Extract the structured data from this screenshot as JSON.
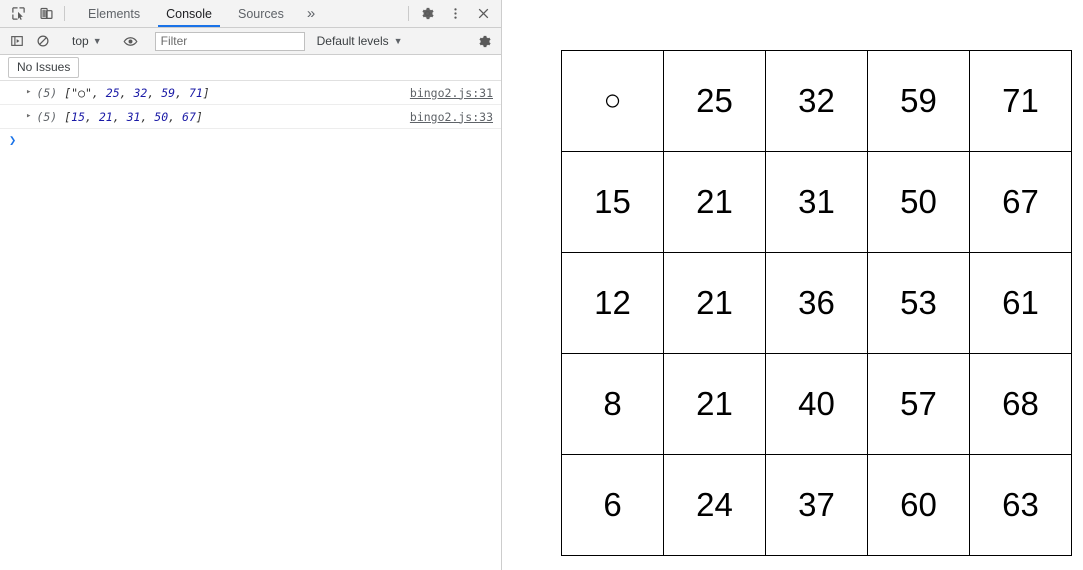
{
  "devtools": {
    "tabbar": {
      "inspect_icon": "inspect-cursor-icon",
      "device_icon": "device-toolbar-icon",
      "tabs": [
        {
          "label": "Elements",
          "active": false
        },
        {
          "label": "Console",
          "active": true
        },
        {
          "label": "Sources",
          "active": false
        }
      ],
      "more_tabs_label": "»",
      "settings_icon": "gear-icon",
      "menu_icon": "kebab-menu-icon",
      "close_icon": "close-icon"
    },
    "toolbar": {
      "sidebar_icon": "console-sidebar-icon",
      "clear_icon": "clear-console-icon",
      "context_label": "top",
      "context_caret": "▼",
      "eye_icon": "live-expression-eye-icon",
      "filter_placeholder": "Filter",
      "filter_value": "",
      "levels_label": "Default levels",
      "levels_caret": "▼",
      "settings_icon": "console-settings-gear-icon"
    },
    "issues": {
      "label": "No Issues"
    },
    "logs": [
      {
        "triangle": "▸",
        "count": "(5)",
        "parts": [
          {
            "t": "[\"",
            "k": "punc"
          },
          {
            "t": "○",
            "k": "str"
          },
          {
            "t": "\", ",
            "k": "punc"
          },
          {
            "t": "25",
            "k": "num"
          },
          {
            "t": ", ",
            "k": "punc"
          },
          {
            "t": "32",
            "k": "num"
          },
          {
            "t": ", ",
            "k": "punc"
          },
          {
            "t": "59",
            "k": "num"
          },
          {
            "t": ", ",
            "k": "punc"
          },
          {
            "t": "71",
            "k": "num"
          },
          {
            "t": "]",
            "k": "punc"
          }
        ],
        "text": "[\"○\", 25, 32, 59, 71]",
        "source": "bingo2.js:31"
      },
      {
        "triangle": "▸",
        "count": "(5)",
        "parts": [
          {
            "t": "[",
            "k": "punc"
          },
          {
            "t": "15",
            "k": "num"
          },
          {
            "t": ", ",
            "k": "punc"
          },
          {
            "t": "21",
            "k": "num"
          },
          {
            "t": ", ",
            "k": "punc"
          },
          {
            "t": "31",
            "k": "num"
          },
          {
            "t": ", ",
            "k": "punc"
          },
          {
            "t": "50",
            "k": "num"
          },
          {
            "t": ", ",
            "k": "punc"
          },
          {
            "t": "67",
            "k": "num"
          },
          {
            "t": "]",
            "k": "punc"
          }
        ],
        "text": "[15, 21, 31, 50, 67]",
        "source": "bingo2.js:33"
      }
    ],
    "prompt": {
      "caret": "❯"
    }
  },
  "page": {
    "bingo": {
      "rows": [
        [
          "○",
          "25",
          "32",
          "59",
          "71"
        ],
        [
          "15",
          "21",
          "31",
          "50",
          "67"
        ],
        [
          "12",
          "21",
          "36",
          "53",
          "61"
        ],
        [
          "8",
          "21",
          "40",
          "57",
          "68"
        ],
        [
          "6",
          "24",
          "37",
          "60",
          "63"
        ]
      ]
    }
  },
  "colors": {
    "accent": "#1a73e8",
    "number_blue": "#1a1aa6",
    "toolbar_bg": "#f3f3f3",
    "border": "#cdcdcd",
    "grid_line": "#000000"
  }
}
